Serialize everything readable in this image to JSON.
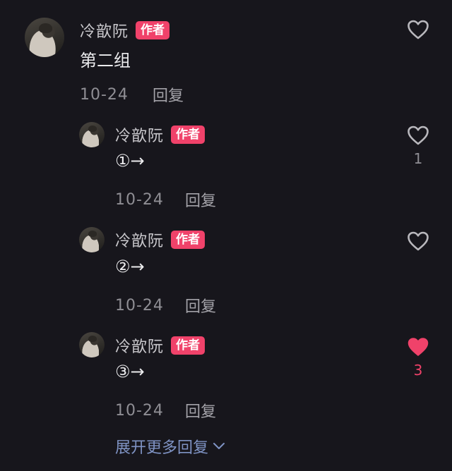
{
  "main_comment": {
    "author": "冷歆阮",
    "badge": "作者",
    "text": "第二组",
    "date": "10-24",
    "reply_label": "回复",
    "liked": false,
    "like_count": ""
  },
  "replies": [
    {
      "author": "冷歆阮",
      "badge": "作者",
      "text": "①→",
      "date": "10-24",
      "reply_label": "回复",
      "liked": false,
      "like_count": "1"
    },
    {
      "author": "冷歆阮",
      "badge": "作者",
      "text": "②→",
      "date": "10-24",
      "reply_label": "回复",
      "liked": false,
      "like_count": ""
    },
    {
      "author": "冷歆阮",
      "badge": "作者",
      "text": "③→",
      "date": "10-24",
      "reply_label": "回复",
      "liked": true,
      "like_count": "3"
    }
  ],
  "expand_label": "展开更多回复",
  "colors": {
    "badge": "#f0426a",
    "liked_heart": "#f0426a",
    "expand_link": "#7f93c4",
    "background": "#17161c"
  },
  "icons": {
    "like": "heart-outline-icon",
    "liked": "heart-filled-icon",
    "expand": "chevron-down-icon"
  }
}
